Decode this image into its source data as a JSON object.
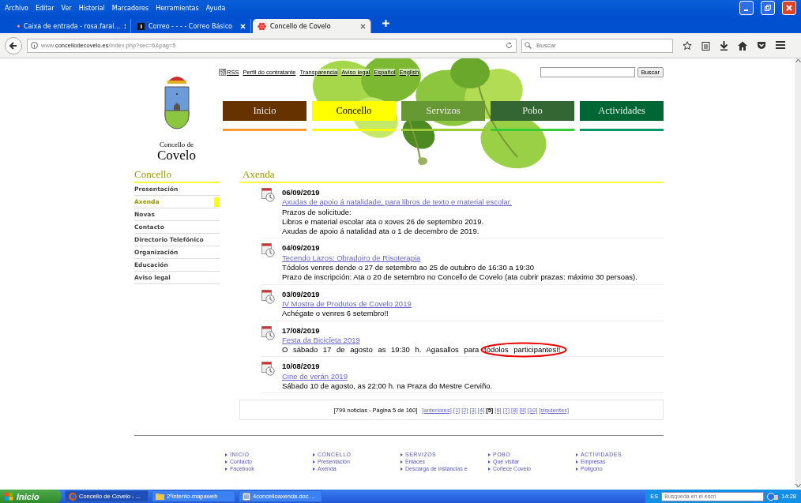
{
  "browser": {
    "menu": [
      "Archivo",
      "Editar",
      "Ver",
      "Historial",
      "Marcadores",
      "Herramientas",
      "Ayuda"
    ],
    "tabs": [
      {
        "label": "Caixa de entrada - rosa.faral...",
        "kind": "mail",
        "selected": false
      },
      {
        "label": "Correo - - - - Correo Básico",
        "kind": "square",
        "selected": false
      },
      {
        "label": "Concello de Covelo",
        "kind": "flower",
        "selected": true
      }
    ],
    "url": "www.**concellodecovelo.es**/index.php?sec=6&pag=5",
    "search_placeholder": "Buscar"
  },
  "site": {
    "logo_line1": "Concello de",
    "logo_line2": "Covelo",
    "top_links": [
      "RSS",
      "Perfil do contratante",
      "Transparencia",
      "Aviso legal",
      "Español",
      "English"
    ],
    "search_button": "Buscar",
    "nav": [
      {
        "label": "Inicio",
        "selected": false,
        "color": "#663300"
      },
      {
        "label": "Concello",
        "selected": true,
        "color": "#ffff00"
      },
      {
        "label": "Servizos",
        "selected": false,
        "color": "#669933"
      },
      {
        "label": "Pobo",
        "selected": false,
        "color": "#336633"
      },
      {
        "label": "Actividades",
        "selected": false,
        "color": "#006633"
      }
    ],
    "sidebar": {
      "title": "Concello",
      "items": [
        {
          "label": "Presentación",
          "selected": false
        },
        {
          "label": "Axenda",
          "selected": true
        },
        {
          "label": "Novas",
          "selected": false
        },
        {
          "label": "Contacto",
          "selected": false
        },
        {
          "label": "Directorio Telefónico",
          "selected": false
        },
        {
          "label": "Organización",
          "selected": false
        },
        {
          "label": "Educación",
          "selected": false
        },
        {
          "label": "Aviso legal",
          "selected": false
        }
      ]
    },
    "content_title": "Axenda",
    "events": [
      {
        "date": "06/09/2019",
        "title": "Axudas de apoio á natalidade, para libros de texto e material escolar.",
        "lines": [
          "Prazos de solicitude:",
          "Libros e material escolar ata o xoves 26 de septembro 2019.",
          "Axudas de apoio á natalidad ata o 1 de decembro de 2019."
        ],
        "circled": false
      },
      {
        "date": "04/09/2019",
        "title": "Tecendo Lazos: Obradoiro de Risoterapia",
        "lines": [
          "Tódolos venres dende o 27 de setembro ao 25 de outubro de 16:30 a 19:30",
          "Prazo de inscripción: Ata o 20 de setembro no Concello de Covelo (ata cubrir prazas: máximo 30 persoas)."
        ],
        "circled": false
      },
      {
        "date": "03/09/2019",
        "title": "IV Mostra de Produtos de Covelo 2019",
        "lines": [
          "Achégate o venres 6 setembro!!"
        ],
        "circled": false
      },
      {
        "date": "17/08/2019",
        "title": "Festa da Bicicleta 2019",
        "lines": [
          "O sábado 17 de agosto as 19:30 h. Agasallos para tódolos participantes!!"
        ],
        "circled": true
      },
      {
        "date": "10/08/2019",
        "title": "Cine de verán 2019",
        "lines": [
          "Sábado 10 de agosto, as 22:00 h. na Praza do Mestre Cerviño."
        ],
        "circled": false
      }
    ],
    "pagination": {
      "summary": "[799 noticias - Página 5 de 160]",
      "links": [
        {
          "label": "[anteriores]",
          "selected": false
        },
        {
          "label": "[1]",
          "selected": false
        },
        {
          "label": "[2]",
          "selected": false
        },
        {
          "label": "[3]",
          "selected": false
        },
        {
          "label": "[4]",
          "selected": false
        },
        {
          "label": "[5]",
          "selected": true
        },
        {
          "label": "[6]",
          "selected": false
        },
        {
          "label": "[7]",
          "selected": false
        },
        {
          "label": "[8]",
          "selected": false
        },
        {
          "label": "[9]",
          "selected": false
        },
        {
          "label": "[10]",
          "selected": false
        },
        {
          "label": "[siguientes]",
          "selected": false
        }
      ]
    },
    "footer": [
      {
        "heading": "INICIO",
        "links": [
          "Contacto",
          "Facebook"
        ]
      },
      {
        "heading": "CONCELLO",
        "links": [
          "Presentación",
          "Axenda"
        ]
      },
      {
        "heading": "SERVIZOS",
        "links": [
          "Enlaces",
          "Descarga de instancias e"
        ]
      },
      {
        "heading": "POBO",
        "links": [
          "Qué visitar",
          "Coñece Covelo"
        ]
      },
      {
        "heading": "ACTIVIDADES",
        "links": [
          "Empresas",
          "Polígono"
        ]
      }
    ]
  },
  "taskbar": {
    "start": "Inicio",
    "tasks": [
      {
        "label": "Concello de Covelo - ...",
        "kind": "browser",
        "selected": true
      },
      {
        "label": "2ºintento-mapaweb",
        "kind": "folder",
        "selected": false
      },
      {
        "label": "4concelloaxenda.doc ...",
        "kind": "document",
        "selected": false
      }
    ],
    "language": "ES",
    "search_placeholder": "Búsqueda en el escri",
    "time": "14:28"
  }
}
